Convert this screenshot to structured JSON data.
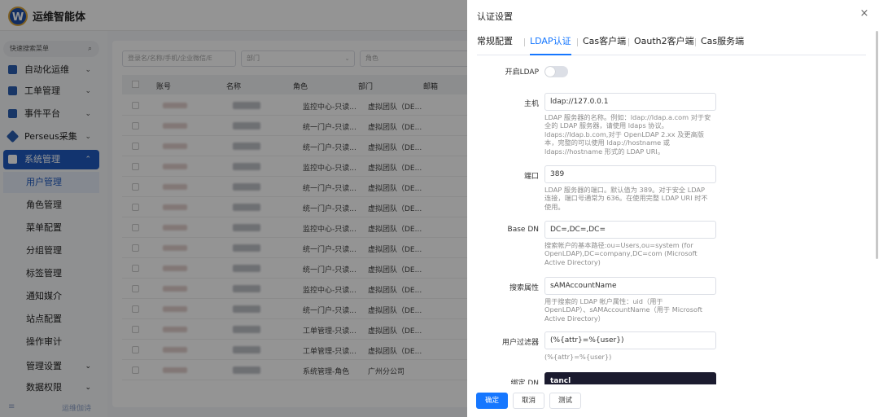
{
  "app": {
    "brand": "运维智能体",
    "logo_letter": "W",
    "sidebar": {
      "search_label": "快速搜索菜单",
      "menu": [
        {
          "label": "自动化运维",
          "icon": "gear-icon"
        },
        {
          "label": "工单管理",
          "icon": "clipboard-icon"
        },
        {
          "label": "事件平台",
          "icon": "flag-icon"
        },
        {
          "label": "Perseus采集",
          "icon": "diamond-icon"
        },
        {
          "label": "系统管理",
          "icon": "system-gear-icon"
        }
      ],
      "submenu": [
        "用户管理",
        "角色管理",
        "菜单配置",
        "分组管理",
        "标签管理",
        "通知媒介",
        "站点配置",
        "操作审计",
        "管理设置",
        "数据权限"
      ],
      "footer_label": "运维伽诗"
    },
    "filters": [
      "登录名/名称/手机/企业微信/E",
      "部门",
      "角色"
    ],
    "table": {
      "columns": [
        "账号",
        "名称",
        "角色",
        "部门",
        "邮箱"
      ],
      "rows": [
        {
          "role": "监控中心-只读...",
          "dept": "虚拟团队（DE..."
        },
        {
          "role": "统一门户-只读...",
          "dept": "虚拟团队（DE..."
        },
        {
          "role": "统一门户-只读...",
          "dept": "虚拟团队（DE..."
        },
        {
          "role": "监控中心-只读...",
          "dept": "虚拟团队（DE..."
        },
        {
          "role": "统一门户-只读...",
          "dept": "虚拟团队（DE..."
        },
        {
          "role": "统一门户-只读...",
          "dept": "虚拟团队（DE..."
        },
        {
          "role": "监控中心-只读...",
          "dept": "虚拟团队（DE..."
        },
        {
          "role": "统一门户-只读...",
          "dept": "虚拟团队（DE..."
        },
        {
          "role": "统一门户-只读...",
          "dept": "虚拟团队（DE..."
        },
        {
          "role": "监控中心-只读...",
          "dept": "虚拟团队（DE..."
        },
        {
          "role": "统一门户-只读...",
          "dept": "虚拟团队（DE..."
        },
        {
          "role": "工单管理-只读...",
          "dept": "虚拟团队（DE..."
        },
        {
          "role": "工单管理-只读...",
          "dept": "虚拟团队（DE..."
        },
        {
          "role": "系统管理-角色",
          "dept": "广州分公司"
        }
      ]
    }
  },
  "drawer": {
    "title": "认证设置",
    "close_icon": "close-icon",
    "tabs": [
      "常规配置",
      "LDAP认证",
      "Cas客户端",
      "Oauth2客户端",
      "Cas服务端"
    ],
    "active_tab": "LDAP认证",
    "fields": {
      "enable": {
        "label": "开启LDAP",
        "value": false
      },
      "host": {
        "label": "主机",
        "value": "ldap://127.0.0.1",
        "help": [
          "LDAP 服务器的名称。例如：ldap://ldap.a.com 对于安",
          "全的 LDAP 服务器，请使用 ldaps 协议。",
          "ldaps://ldap.b.com,对于 OpenLDAP 2.xx 及更高版",
          "本，完整的可以使用 ldap://hostname 或",
          "ldaps://hostname 形式的 LDAP URI。"
        ]
      },
      "port": {
        "label": "端口",
        "value": "389",
        "help": [
          "LDAP 服务器的端口。默认值为 389。对于安全 LDAP",
          "连接，端口号通常为 636。在使用完整 LDAP URI 时不",
          "使用。"
        ]
      },
      "base_dn": {
        "label": "Base DN",
        "value": "DC=,DC=,DC=",
        "help": [
          "搜索帐户的基本路径:ou=Users,ou=system (for",
          "OpenLDAP),DC=company,DC=com (Microsoft",
          "Active Directory)"
        ]
      },
      "search_attr": {
        "label": "搜索属性",
        "value": "sAMAccountName",
        "help": [
          "用于搜索的 LDAP 帐户属性：uid（用于",
          "OpenLDAP）、sAMAccountName（用于 Microsoft",
          "Active Directory）"
        ]
      },
      "user_filter": {
        "label": "用户过滤器",
        "value": "(%{attr}=%{user})",
        "help": [
          "(%{attr}=%{user})"
        ]
      },
      "bind_dn": {
        "label": "绑定 DN",
        "value": "tancl"
      }
    },
    "buttons": {
      "confirm": "确定",
      "cancel": "取消",
      "test": "测试"
    },
    "colors": {
      "primary": "#1677ff",
      "mask": "rgba(0,0,0,0.42)"
    }
  }
}
